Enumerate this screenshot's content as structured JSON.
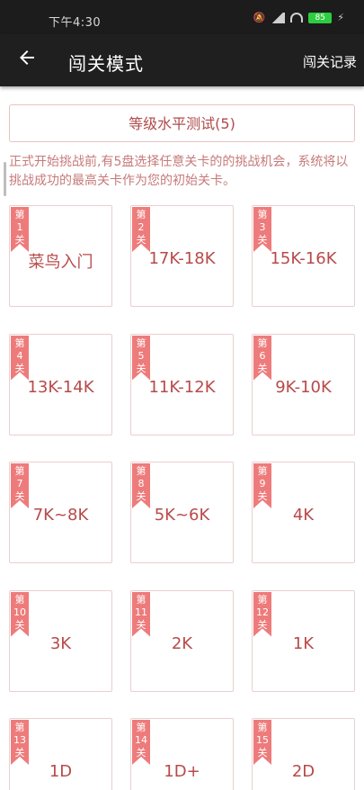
{
  "status_bar": {
    "time": "下午4:30",
    "battery": "85"
  },
  "app_bar": {
    "title": "闯关模式",
    "record_label": "闯关记录"
  },
  "test_button": {
    "label": "等级水平测试(5)"
  },
  "description": "正式开始挑战前,有5盘选择任意关卡的的挑战机会，系统将以挑战成功的最高关卡作为您的初始关卡。",
  "levels": [
    {
      "tag": [
        "第",
        "1",
        "关"
      ],
      "name": "菜鸟入门"
    },
    {
      "tag": [
        "第",
        "2",
        "关"
      ],
      "name": "17K-18K"
    },
    {
      "tag": [
        "第",
        "3",
        "关"
      ],
      "name": "15K-16K"
    },
    {
      "tag": [
        "第",
        "4",
        "关"
      ],
      "name": "13K-14K"
    },
    {
      "tag": [
        "第",
        "5",
        "关"
      ],
      "name": "11K-12K"
    },
    {
      "tag": [
        "第",
        "6",
        "关"
      ],
      "name": "9K-10K"
    },
    {
      "tag": [
        "第",
        "7",
        "关"
      ],
      "name": "7K~8K"
    },
    {
      "tag": [
        "第",
        "8",
        "关"
      ],
      "name": "5K~6K"
    },
    {
      "tag": [
        "第",
        "9",
        "关"
      ],
      "name": "4K"
    },
    {
      "tag": [
        "第",
        "10",
        "关"
      ],
      "name": "3K"
    },
    {
      "tag": [
        "第",
        "11",
        "关"
      ],
      "name": "2K"
    },
    {
      "tag": [
        "第",
        "12",
        "关"
      ],
      "name": "1K"
    },
    {
      "tag": [
        "第",
        "13",
        "关"
      ],
      "name": "1D"
    },
    {
      "tag": [
        "第",
        "14",
        "关"
      ],
      "name": "1D+"
    },
    {
      "tag": [
        "第",
        "15",
        "关"
      ],
      "name": "2D"
    }
  ],
  "colors": {
    "accent": "#ee7b7b",
    "text": "#b84a4a",
    "border": "#ebcfcf",
    "appbar": "#1f1f1f"
  }
}
